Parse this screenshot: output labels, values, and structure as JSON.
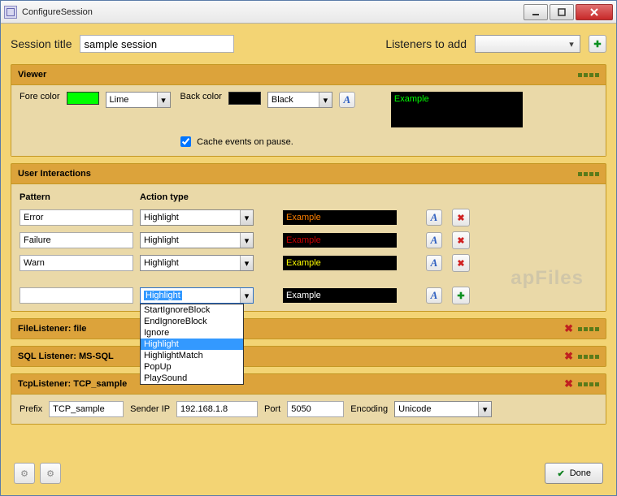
{
  "window": {
    "title": "ConfigureSession"
  },
  "top": {
    "session_title_label": "Session title",
    "session_title_value": "sample session",
    "listeners_label": "Listeners to add",
    "listeners_value": ""
  },
  "viewer": {
    "header": "Viewer",
    "fore_label": "Fore color",
    "fore_swatch": "#00ff00",
    "fore_value": "Lime",
    "back_label": "Back color",
    "back_swatch": "#000000",
    "back_value": "Black",
    "cache_label": "Cache events on pause.",
    "cache_checked": true,
    "preview_text": "Example",
    "preview_color": "#00ff00"
  },
  "interactions": {
    "header": "User Interactions",
    "col_pattern": "Pattern",
    "col_action": "Action type",
    "rows": [
      {
        "pattern": "Error",
        "action": "Highlight",
        "example": "Example",
        "color": "#ff8000"
      },
      {
        "pattern": "Failure",
        "action": "Highlight",
        "example": "Example",
        "color": "#d00000"
      },
      {
        "pattern": "Warn",
        "action": "Highlight",
        "example": "Example",
        "color": "#ffff00"
      }
    ],
    "newrow": {
      "pattern": "",
      "action": "Highlight",
      "example": "Example",
      "color": "#ffffff"
    },
    "dropdown_options": [
      "StartIgnoreBlock",
      "EndIgnoreBlock",
      "Ignore",
      "Highlight",
      "HighlightMatch",
      "PopUp",
      "PlaySound"
    ],
    "dropdown_selected": "Highlight"
  },
  "file_listener": {
    "header": "FileListener: file"
  },
  "sql_listener": {
    "header": "SQL Listener: MS-SQL"
  },
  "tcp_listener": {
    "header": "TcpListener: TCP_sample",
    "prefix_label": "Prefix",
    "prefix_value": "TCP_sample",
    "senderip_label": "Sender IP",
    "senderip_value": "192.168.1.8",
    "port_label": "Port",
    "port_value": "5050",
    "encoding_label": "Encoding",
    "encoding_value": "Unicode"
  },
  "bottom": {
    "done": "Done"
  },
  "watermark": "apFiles"
}
